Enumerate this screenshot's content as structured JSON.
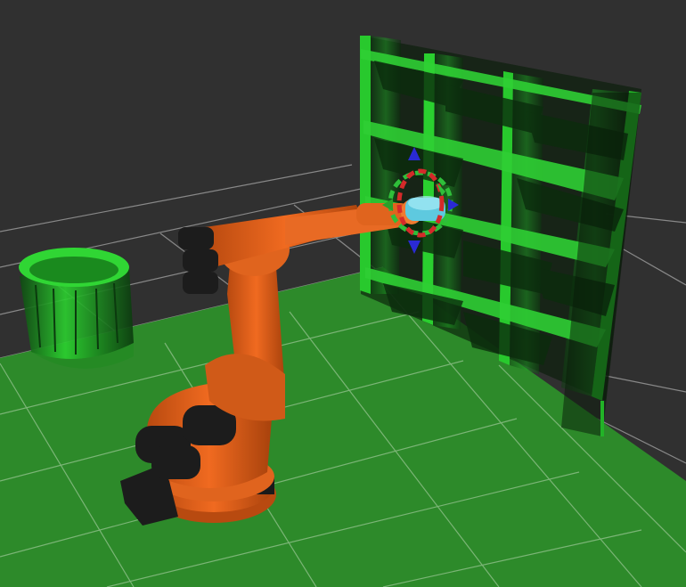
{
  "viewport": {
    "background_color": "#303030",
    "grid_color": "#a0a0a0",
    "floor_color": "#2d8a2a",
    "obstacle_color": "#22c02a",
    "robot_color": "#e0641e",
    "robot_dark_color": "#1c1c1c",
    "end_effector_color": "#5ec9df"
  },
  "objects": [
    {
      "name": "floor-plane"
    },
    {
      "name": "reference-grid"
    },
    {
      "name": "bookshelf-obstacle"
    },
    {
      "name": "cylinder-obstacle"
    },
    {
      "name": "industrial-robot-arm"
    },
    {
      "name": "interactive-marker"
    }
  ]
}
